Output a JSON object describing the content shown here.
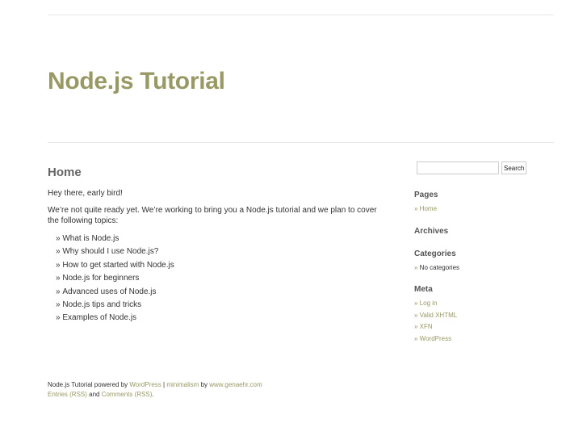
{
  "site": {
    "title": "Node.js Tutorial"
  },
  "page": {
    "title": "Home",
    "intro": "Hey there, early bird!",
    "description": "We’re not quite ready yet. We’re working to bring you a Node.js tutorial and we plan to cover the following topics:",
    "topics": [
      "What is Node.js",
      "Why should I use Node.js?",
      "How to get started with Node.js",
      "Node.js for beginners",
      "Advanced uses of Node.js",
      "Node.js tips and tricks",
      "Examples of Node.js"
    ]
  },
  "sidebar": {
    "search": {
      "value": "",
      "button_label": "Search"
    },
    "pages": {
      "title": "Pages",
      "items": [
        "Home"
      ]
    },
    "archives": {
      "title": "Archives"
    },
    "categories": {
      "title": "Categories",
      "items": [
        "No categories"
      ]
    },
    "meta": {
      "title": "Meta",
      "items": [
        "Log in",
        "Valid XHTML",
        "XFN",
        "WordPress"
      ]
    }
  },
  "footer": {
    "line1_prefix": "Node.js Tutorial powered by ",
    "wordpress_link": "WordPress",
    "separator": " | ",
    "theme_link": "minimalism",
    "by_text": " by ",
    "author_link": "www.genaehr.com",
    "entries_link": "Entries (RSS)",
    "and_text": " and ",
    "comments_link": "Comments (RSS)",
    "period": "."
  },
  "colors": {
    "accent": "#999966",
    "text": "#333333",
    "heading": "#666666",
    "rule": "#e8e8e8"
  }
}
